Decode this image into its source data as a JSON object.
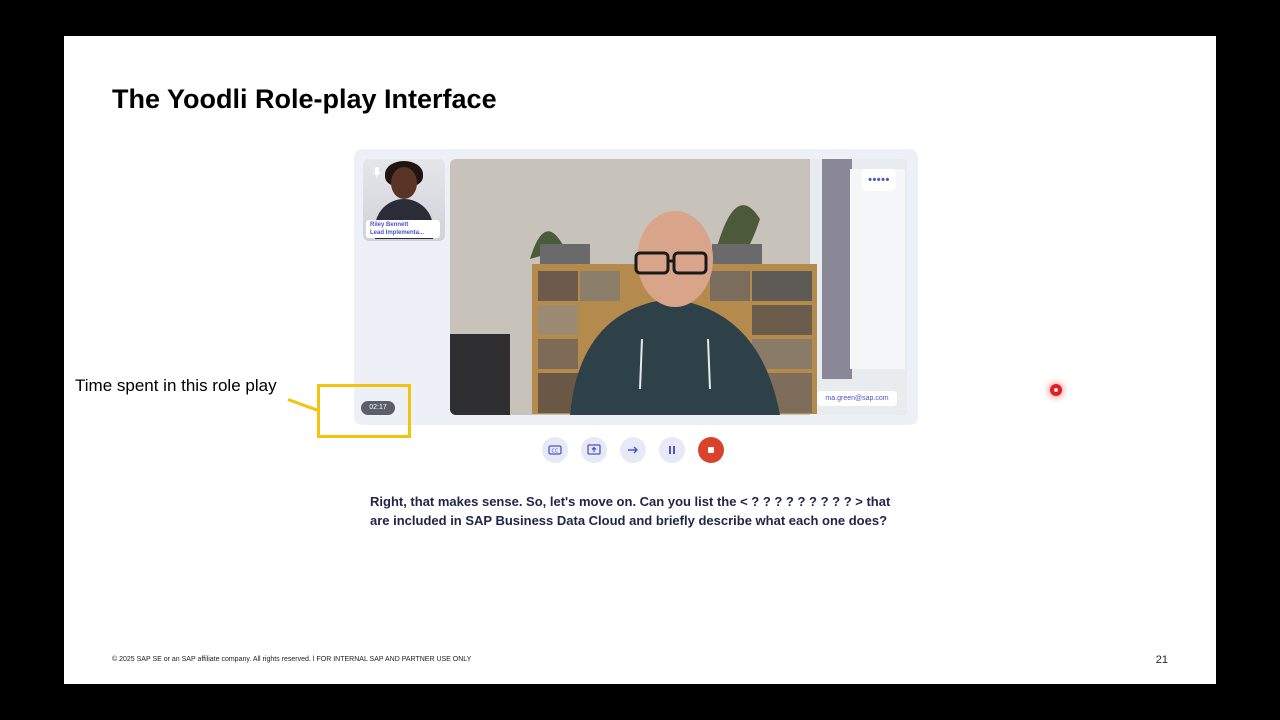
{
  "slide": {
    "title": "The Yoodli Role-play Interface",
    "footer": "© 2025 SAP SE or an SAP affiliate company. All rights reserved.  ǀ   FOR INTERNAL SAP AND PARTNER USE ONLY",
    "page_number": "21"
  },
  "participant": {
    "name": "Riley Bennett",
    "role": "Lead Implementa..."
  },
  "video": {
    "menu_label": "•••••",
    "email": "ma.green@sap.com"
  },
  "timer": {
    "value": "02:17"
  },
  "callout": {
    "text": "Time spent in this role play",
    "color": "#f2c30f"
  },
  "controls": [
    {
      "icon": "captions-icon"
    },
    {
      "icon": "share-screen-icon"
    },
    {
      "icon": "arrow-right-icon"
    },
    {
      "icon": "pause-icon"
    },
    {
      "icon": "stop-icon",
      "color": "#d9432c"
    }
  ],
  "prompt": {
    "text": "Right, that makes sense. So, let's move on. Can you list the < ? ? ? ? ? ? ? ? ? >          that are included in SAP Business Data Cloud and briefly describe what each one does?"
  }
}
